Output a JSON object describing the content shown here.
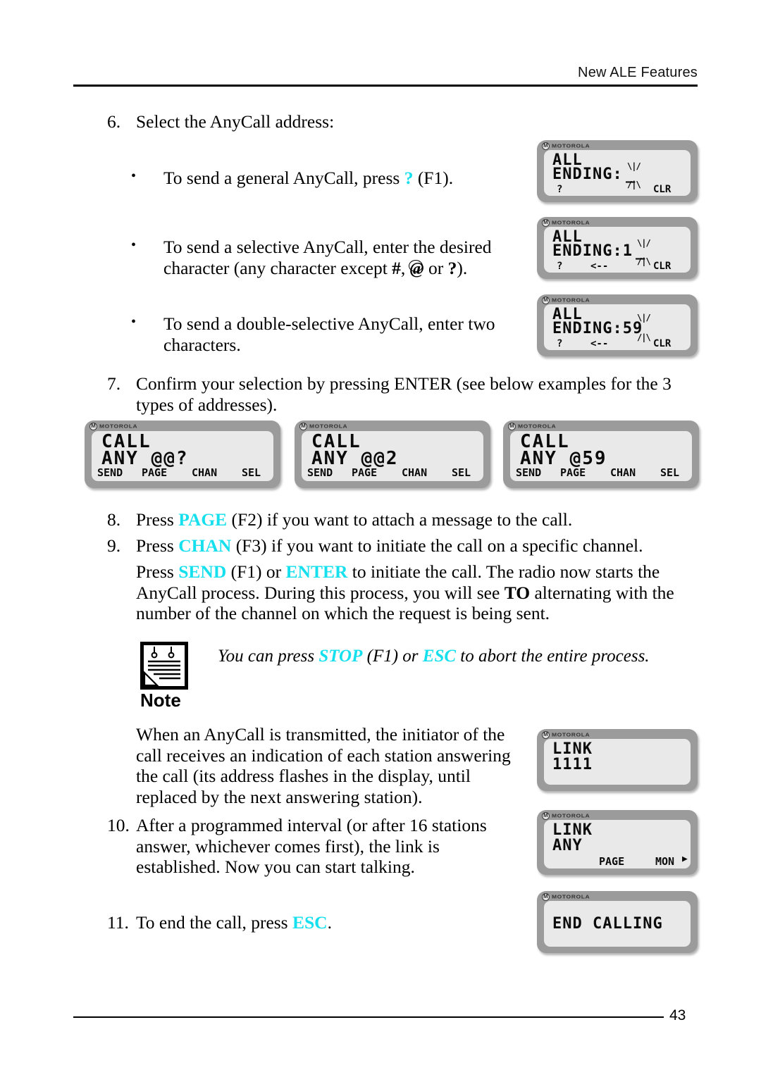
{
  "header": {
    "title": "New ALE Features"
  },
  "footer": {
    "page_number": "43"
  },
  "steps": {
    "s6_num": "6.",
    "s6_text": "Select the AnyCall address:",
    "b1_pre": "To send a general AnyCall, press ",
    "b1_key": "?",
    "b1_post": " (F1).",
    "b2_line1": "To send a selective AnyCall, enter the desired",
    "b2_line2_a": "character (any character except ",
    "b2_hash": "#",
    "b2_line2_b": ", ",
    "b2_at": "@",
    "b2_line2_c": " or ",
    "b2_q": "?",
    "b2_line2_d": ").",
    "b3_line1": "To send a double-selective AnyCall, enter two",
    "b3_line2": "characters.",
    "s7_num": "7.",
    "s7_line1": "Confirm your selection by pressing ENTER (see below examples for the 3",
    "s7_line2": "types of addresses).",
    "s8_num": "8.",
    "s8_pre": "Press ",
    "s8_key": "PAGE",
    "s8_post": " (F2) if you want to attach a message to the call.",
    "s9_num": "9.",
    "s9_pre": "Press ",
    "s9_key": "CHAN",
    "s9_post": " (F3) if you want to initiate the call on a specific channel.",
    "s9b_pre": "Press ",
    "s9b_key1": "SEND",
    "s9b_mid": " (F1) or ",
    "s9b_key2": "ENTER",
    "s9b_post": " to initiate the call. The radio now starts the",
    "s9b_line2_a": "AnyCall process. During this process, you will see ",
    "s9b_to": "TO",
    "s9b_line2_b": " alternating with the",
    "s9b_line3": "number of the channel on which the request is being sent.",
    "s10_num": "10.",
    "s10_line1": "After a programmed interval (or after 16 stations",
    "s10_line2": "answer, whichever comes first), the link is",
    "s10_line3": "established. Now you can start talking.",
    "s11_num": "11.",
    "s11_pre": "To end the call, press ",
    "s11_key": "ESC",
    "s11_post": "."
  },
  "note": {
    "label": "Note",
    "text_pre": "You can press ",
    "key1": "STOP",
    "text_mid": " (F1) or ",
    "key2": "ESC",
    "text_post": " to abort the entire process.",
    "body_line1": "When an AnyCall is transmitted, the initiator of the",
    "body_line2": "call receives an indication of each station answering",
    "body_line3": "the call (its address flashes in the display, until",
    "body_line4": "replaced by the next answering station)."
  },
  "brand": {
    "name": "MOTOROLA",
    "mark": "M"
  },
  "displays": {
    "all_ending_blank": {
      "line1": "ALL",
      "line2": "ENDING:",
      "cursor": "_",
      "softkey_left": "?",
      "softkey_mid": "",
      "softkey_right": "CLR"
    },
    "all_ending_1": {
      "line1": "ALL",
      "line2": "ENDING:1",
      "cursor": "_",
      "softkey_left": "?",
      "softkey_mid": "<--",
      "softkey_right": "CLR"
    },
    "all_ending_59": {
      "line1": "ALL",
      "line2": "ENDING:59",
      "cursor": "",
      "softkey_left": "?",
      "softkey_mid": "<--",
      "softkey_right": "CLR"
    },
    "call_any_qq": {
      "line1": "CALL",
      "line2": "ANY @@?",
      "softkeys": [
        "SEND",
        "PAGE",
        "CHAN",
        "SEL"
      ]
    },
    "call_any_2": {
      "line1": "CALL",
      "line2": "ANY @@2",
      "softkeys": [
        "SEND",
        "PAGE",
        "CHAN",
        "SEL"
      ]
    },
    "call_any_59": {
      "line1": "CALL",
      "line2": "ANY @59",
      "softkeys": [
        "SEND",
        "PAGE",
        "CHAN",
        "SEL"
      ]
    },
    "link_1111": {
      "line1": "LINK",
      "line2": "1111"
    },
    "link_any": {
      "line1": "LINK",
      "line2": "ANY",
      "softkey_mid": "PAGE",
      "softkey_right": "MON",
      "softkey_right_arrow": "▶"
    },
    "end_calling": {
      "line1": "END CALLING"
    }
  }
}
